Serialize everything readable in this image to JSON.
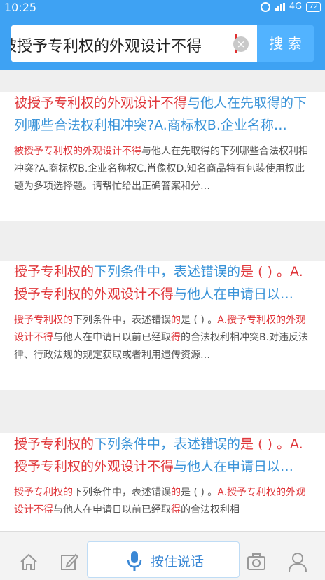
{
  "status_bar": {
    "time": "10:25",
    "network": "4G",
    "battery": "72"
  },
  "search": {
    "query": "被授予专利权的外观设计不得",
    "clear_symbol": "×",
    "button_label": "搜 索"
  },
  "results": [
    {
      "title": [
        {
          "text": "被授予专利权的外观设计不得",
          "hl": true
        },
        {
          "text": "与他人在先取得的下列哪些合法权利相冲突?A.商标权B.企业名称…",
          "hl": false
        }
      ],
      "snippet": [
        {
          "text": "被授予专利权的外观设计不得",
          "hl": true
        },
        {
          "text": "与他人在先取得的下列哪些合法权利相冲突?A.商标权B.企业名称权C.肖像权D.知名商品特有包装使用权此题为多项选择题。请帮忙给出正确答案和分…",
          "hl": false
        }
      ]
    },
    {
      "title": [
        {
          "text": "授予专利权的",
          "hl": true
        },
        {
          "text": "下列条件中，表述错误的",
          "hl": false
        },
        {
          "text": "是 ( ) 。A.授予专利权的外观设计不得",
          "hl": true
        },
        {
          "text": "与他人在申请日以…",
          "hl": false
        }
      ],
      "snippet": [
        {
          "text": "授予专利权的",
          "hl": true
        },
        {
          "text": "下列条件中，表述错误",
          "hl": false
        },
        {
          "text": "的",
          "hl": true
        },
        {
          "text": "是 ( ) 。",
          "hl": false
        },
        {
          "text": "A.授予专利权的外观设计不得",
          "hl": true
        },
        {
          "text": "与他人在申请日以前已经取",
          "hl": false
        },
        {
          "text": "得",
          "hl": true
        },
        {
          "text": "的合法权利相冲突B.对违反法律、行政法规的规定获取或者利用遗传资源…",
          "hl": false
        }
      ]
    },
    {
      "title": [
        {
          "text": "授予专利权的",
          "hl": true
        },
        {
          "text": "下列条件中，表述错误的",
          "hl": false
        },
        {
          "text": "是 ( ) 。A.授予专利权的外观设计不得",
          "hl": true
        },
        {
          "text": "与他人在申请日以…",
          "hl": false
        }
      ],
      "snippet": [
        {
          "text": "授予专利权的",
          "hl": true
        },
        {
          "text": "下列条件中，表述错误",
          "hl": false
        },
        {
          "text": "的",
          "hl": true
        },
        {
          "text": "是 ( ) 。",
          "hl": false
        },
        {
          "text": "A.授予专利权的外观设计不得",
          "hl": true
        },
        {
          "text": "与他人在申请日以前已经取",
          "hl": false
        },
        {
          "text": "得",
          "hl": true
        },
        {
          "text": "的合法权利相",
          "hl": false
        }
      ]
    }
  ],
  "bottom_bar": {
    "voice_label": "按住说话"
  },
  "colors": {
    "header": "#3ea2f3",
    "search_button": "#52b3ff",
    "highlight": "#e0383c",
    "link": "#3a93d8"
  },
  "icons": [
    "alarm-icon",
    "signal-icon",
    "battery-icon",
    "clear-icon",
    "home-icon",
    "edit-icon",
    "mic-icon",
    "camera-icon",
    "user-icon"
  ]
}
